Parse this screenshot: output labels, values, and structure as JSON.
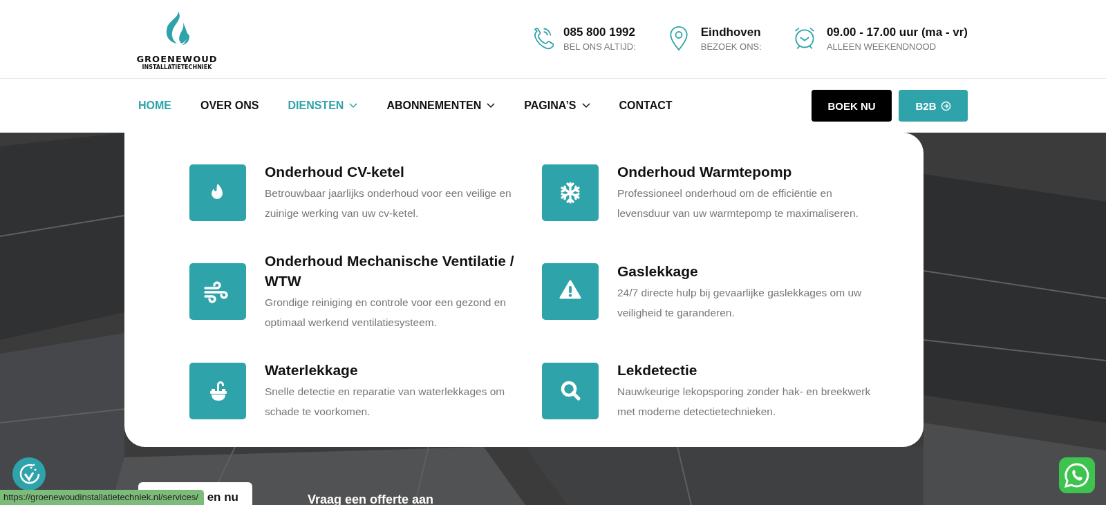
{
  "logo": {
    "name": "GROENEWOUD",
    "subtitle": "INSTALLATIETECHNIEK"
  },
  "contacts": [
    {
      "kind": "phone",
      "value": "085 800 1992",
      "label": "BEL ONS ALTIJD:"
    },
    {
      "kind": "location",
      "value": "Eindhoven",
      "label": "BEZOEK ONS:"
    },
    {
      "kind": "clock",
      "value": "09.00 - 17.00 uur (ma - vr)",
      "label": "ALLEEN WEEKENDNOOD"
    }
  ],
  "nav": [
    {
      "label": "HOME",
      "active": true,
      "dropdown": false
    },
    {
      "label": "OVER ONS",
      "active": false,
      "dropdown": false
    },
    {
      "label": "DIENSTEN",
      "active": true,
      "dropdown": true
    },
    {
      "label": "ABONNEMENTEN",
      "active": false,
      "dropdown": true
    },
    {
      "label": "PAGINA’S",
      "active": false,
      "dropdown": true
    },
    {
      "label": "CONTACT",
      "active": false,
      "dropdown": false
    }
  ],
  "buttons": [
    {
      "label": "BOEK NU",
      "kind": "dark"
    },
    {
      "label": "B2B",
      "kind": "accent"
    }
  ],
  "services_menu": [
    {
      "kind": "flame",
      "title": "Onderhoud CV-ketel",
      "description": "Betrouwbaar jaarlijks onderhoud voor een veilige en zuinige werking van uw cv-ketel."
    },
    {
      "kind": "snowflake",
      "title": "Onderhoud Warmtepomp",
      "description": "Professioneel onderhoud om de efficiëntie en levensduur van uw warmtepomp te maximaliseren."
    },
    {
      "kind": "wind",
      "title": "Onderhoud Mechanische Ventilatie / WTW",
      "description": "Grondige reiniging en controle voor een gezond en optimaal werkend ventilatiesysteem."
    },
    {
      "kind": "warning",
      "title": "Gaslekkage",
      "description": "24/7 directe hulp bij gevaarlijke gaslekkages om uw veiligheid te garanderen."
    },
    {
      "kind": "sink",
      "title": "Waterlekkage",
      "description": "Snelle detectie en reparatie van waterlekkages om schade te voorkomen."
    },
    {
      "kind": "search",
      "title": "Lekdetectie",
      "description": "Nauwkeurige lekopsporing zonder hak- en breekwerk met moderne detectietechnieken."
    }
  ],
  "hero": {
    "button": "en nu",
    "heading": "Vraag een offerte aan"
  },
  "status_bar": {
    "url": "https://groenewoudinstallatietechniek.nl/services/"
  }
}
